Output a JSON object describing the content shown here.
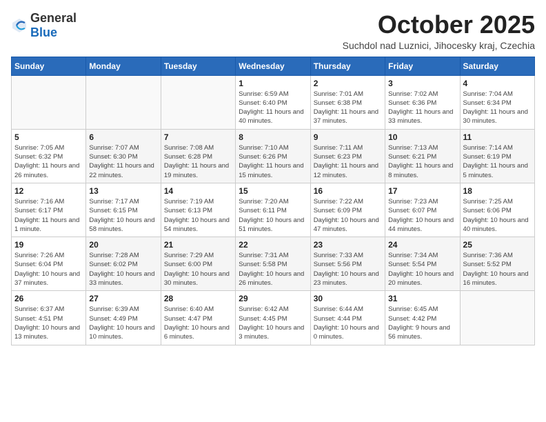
{
  "logo": {
    "general": "General",
    "blue": "Blue"
  },
  "title": "October 2025",
  "subtitle": "Suchdol nad Luznici, Jihocesky kraj, Czechia",
  "weekdays": [
    "Sunday",
    "Monday",
    "Tuesday",
    "Wednesday",
    "Thursday",
    "Friday",
    "Saturday"
  ],
  "weeks": [
    [
      {
        "day": "",
        "info": ""
      },
      {
        "day": "",
        "info": ""
      },
      {
        "day": "",
        "info": ""
      },
      {
        "day": "1",
        "info": "Sunrise: 6:59 AM\nSunset: 6:40 PM\nDaylight: 11 hours and 40 minutes."
      },
      {
        "day": "2",
        "info": "Sunrise: 7:01 AM\nSunset: 6:38 PM\nDaylight: 11 hours and 37 minutes."
      },
      {
        "day": "3",
        "info": "Sunrise: 7:02 AM\nSunset: 6:36 PM\nDaylight: 11 hours and 33 minutes."
      },
      {
        "day": "4",
        "info": "Sunrise: 7:04 AM\nSunset: 6:34 PM\nDaylight: 11 hours and 30 minutes."
      }
    ],
    [
      {
        "day": "5",
        "info": "Sunrise: 7:05 AM\nSunset: 6:32 PM\nDaylight: 11 hours and 26 minutes."
      },
      {
        "day": "6",
        "info": "Sunrise: 7:07 AM\nSunset: 6:30 PM\nDaylight: 11 hours and 22 minutes."
      },
      {
        "day": "7",
        "info": "Sunrise: 7:08 AM\nSunset: 6:28 PM\nDaylight: 11 hours and 19 minutes."
      },
      {
        "day": "8",
        "info": "Sunrise: 7:10 AM\nSunset: 6:26 PM\nDaylight: 11 hours and 15 minutes."
      },
      {
        "day": "9",
        "info": "Sunrise: 7:11 AM\nSunset: 6:23 PM\nDaylight: 11 hours and 12 minutes."
      },
      {
        "day": "10",
        "info": "Sunrise: 7:13 AM\nSunset: 6:21 PM\nDaylight: 11 hours and 8 minutes."
      },
      {
        "day": "11",
        "info": "Sunrise: 7:14 AM\nSunset: 6:19 PM\nDaylight: 11 hours and 5 minutes."
      }
    ],
    [
      {
        "day": "12",
        "info": "Sunrise: 7:16 AM\nSunset: 6:17 PM\nDaylight: 11 hours and 1 minute."
      },
      {
        "day": "13",
        "info": "Sunrise: 7:17 AM\nSunset: 6:15 PM\nDaylight: 10 hours and 58 minutes."
      },
      {
        "day": "14",
        "info": "Sunrise: 7:19 AM\nSunset: 6:13 PM\nDaylight: 10 hours and 54 minutes."
      },
      {
        "day": "15",
        "info": "Sunrise: 7:20 AM\nSunset: 6:11 PM\nDaylight: 10 hours and 51 minutes."
      },
      {
        "day": "16",
        "info": "Sunrise: 7:22 AM\nSunset: 6:09 PM\nDaylight: 10 hours and 47 minutes."
      },
      {
        "day": "17",
        "info": "Sunrise: 7:23 AM\nSunset: 6:07 PM\nDaylight: 10 hours and 44 minutes."
      },
      {
        "day": "18",
        "info": "Sunrise: 7:25 AM\nSunset: 6:06 PM\nDaylight: 10 hours and 40 minutes."
      }
    ],
    [
      {
        "day": "19",
        "info": "Sunrise: 7:26 AM\nSunset: 6:04 PM\nDaylight: 10 hours and 37 minutes."
      },
      {
        "day": "20",
        "info": "Sunrise: 7:28 AM\nSunset: 6:02 PM\nDaylight: 10 hours and 33 minutes."
      },
      {
        "day": "21",
        "info": "Sunrise: 7:29 AM\nSunset: 6:00 PM\nDaylight: 10 hours and 30 minutes."
      },
      {
        "day": "22",
        "info": "Sunrise: 7:31 AM\nSunset: 5:58 PM\nDaylight: 10 hours and 26 minutes."
      },
      {
        "day": "23",
        "info": "Sunrise: 7:33 AM\nSunset: 5:56 PM\nDaylight: 10 hours and 23 minutes."
      },
      {
        "day": "24",
        "info": "Sunrise: 7:34 AM\nSunset: 5:54 PM\nDaylight: 10 hours and 20 minutes."
      },
      {
        "day": "25",
        "info": "Sunrise: 7:36 AM\nSunset: 5:52 PM\nDaylight: 10 hours and 16 minutes."
      }
    ],
    [
      {
        "day": "26",
        "info": "Sunrise: 6:37 AM\nSunset: 4:51 PM\nDaylight: 10 hours and 13 minutes."
      },
      {
        "day": "27",
        "info": "Sunrise: 6:39 AM\nSunset: 4:49 PM\nDaylight: 10 hours and 10 minutes."
      },
      {
        "day": "28",
        "info": "Sunrise: 6:40 AM\nSunset: 4:47 PM\nDaylight: 10 hours and 6 minutes."
      },
      {
        "day": "29",
        "info": "Sunrise: 6:42 AM\nSunset: 4:45 PM\nDaylight: 10 hours and 3 minutes."
      },
      {
        "day": "30",
        "info": "Sunrise: 6:44 AM\nSunset: 4:44 PM\nDaylight: 10 hours and 0 minutes."
      },
      {
        "day": "31",
        "info": "Sunrise: 6:45 AM\nSunset: 4:42 PM\nDaylight: 9 hours and 56 minutes."
      },
      {
        "day": "",
        "info": ""
      }
    ]
  ]
}
